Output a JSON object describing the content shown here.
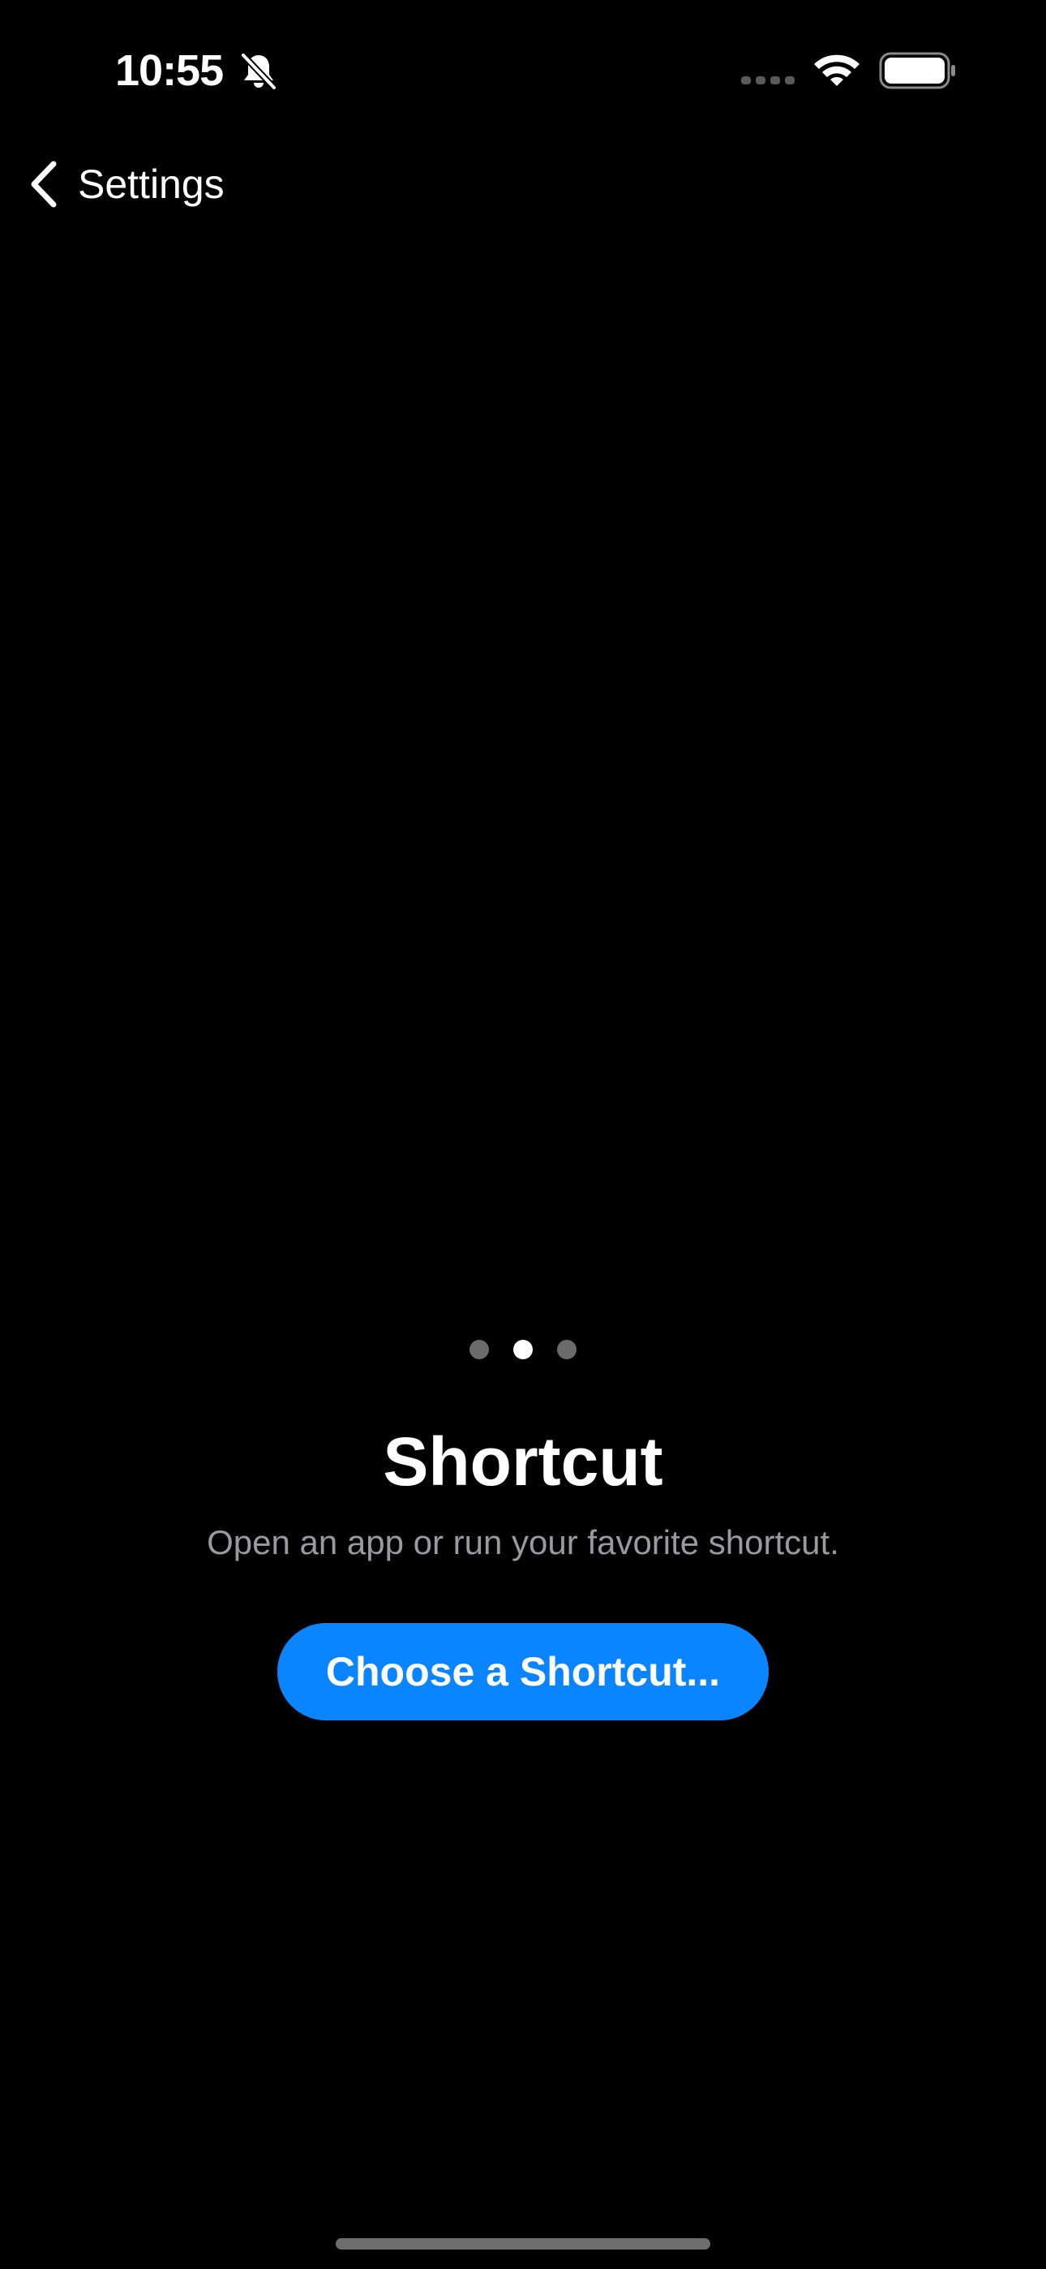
{
  "status_bar": {
    "time": "10:55",
    "icons": [
      "bell-slash-icon",
      "cellular-signal-icon",
      "wifi-icon",
      "battery-icon"
    ]
  },
  "nav": {
    "back_label": "Settings",
    "back_icon": "chevron-left-icon"
  },
  "pager": {
    "page_count": 3,
    "current_page": 2
  },
  "content": {
    "title": "Shortcut",
    "subtitle": "Open an app or run your favorite shortcut.",
    "button_label": "Choose a Shortcut..."
  },
  "colors": {
    "background": "#000000",
    "accent": "#0a84ff",
    "subtitle_text": "#9a9a9e",
    "inactive_dot": "#6b6b6b"
  }
}
